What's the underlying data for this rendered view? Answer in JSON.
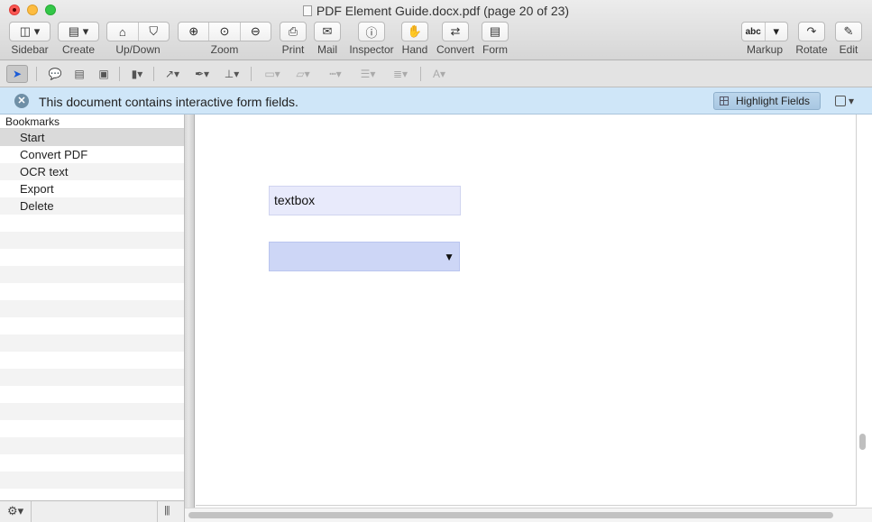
{
  "window": {
    "title": "PDF Element Guide.docx.pdf (page 20 of 23)"
  },
  "toolbar": {
    "sidebar": "Sidebar",
    "create": "Create",
    "updown": "Up/Down",
    "zoom": "Zoom",
    "print": "Print",
    "mail": "Mail",
    "inspector": "Inspector",
    "hand": "Hand",
    "convert": "Convert",
    "form": "Form",
    "markup": "Markup",
    "rotate": "Rotate",
    "edit": "Edit",
    "markup_abc": "abc"
  },
  "notification": {
    "message": "This document contains interactive form fields.",
    "highlight_fields": "Highlight Fields"
  },
  "sidebar": {
    "heading": "Bookmarks",
    "items": [
      {
        "label": "Start"
      },
      {
        "label": "Convert PDF"
      },
      {
        "label": "OCR text"
      },
      {
        "label": "Export"
      },
      {
        "label": "Delete"
      }
    ]
  },
  "form": {
    "textbox_value": "textbox"
  }
}
